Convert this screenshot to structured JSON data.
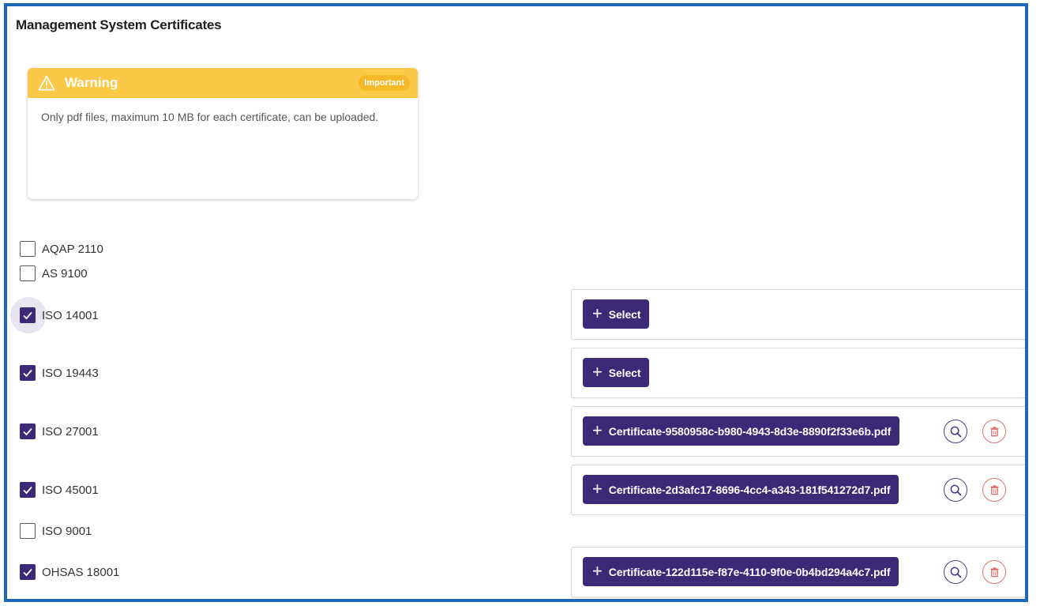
{
  "page": {
    "title": "Management System Certificates"
  },
  "warning": {
    "title": "Warning",
    "badge": "Important",
    "message": "Only pdf files, maximum 10 MB for each certificate, can be uploaded."
  },
  "certificates": [
    {
      "label": "AQAP 2110",
      "checked": false
    },
    {
      "label": "AS 9100",
      "checked": false
    },
    {
      "label": "ISO 14001",
      "checked": true,
      "upload": {
        "button": "Select"
      }
    },
    {
      "label": "ISO 19443",
      "checked": true,
      "upload": {
        "button": "Select"
      }
    },
    {
      "label": "ISO 27001",
      "checked": true,
      "upload": {
        "button": "Certificate-9580958c-b980-4943-8d3e-8890f2f33e6b.pdf"
      }
    },
    {
      "label": "ISO 45001",
      "checked": true,
      "upload": {
        "button": "Certificate-2d3afc17-8696-4cc4-a343-181f541272d7.pdf"
      }
    },
    {
      "label": "ISO 9001",
      "checked": false
    },
    {
      "label": "OHSAS 18001",
      "checked": true,
      "upload": {
        "button": "Certificate-122d115e-f87e-4110-9f0e-0b4bd294a4c7.pdf"
      }
    }
  ],
  "colors": {
    "accent": "#3c2a78",
    "warning": "#fbc947",
    "frame": "#1f67b9",
    "delete": "#df7070"
  }
}
